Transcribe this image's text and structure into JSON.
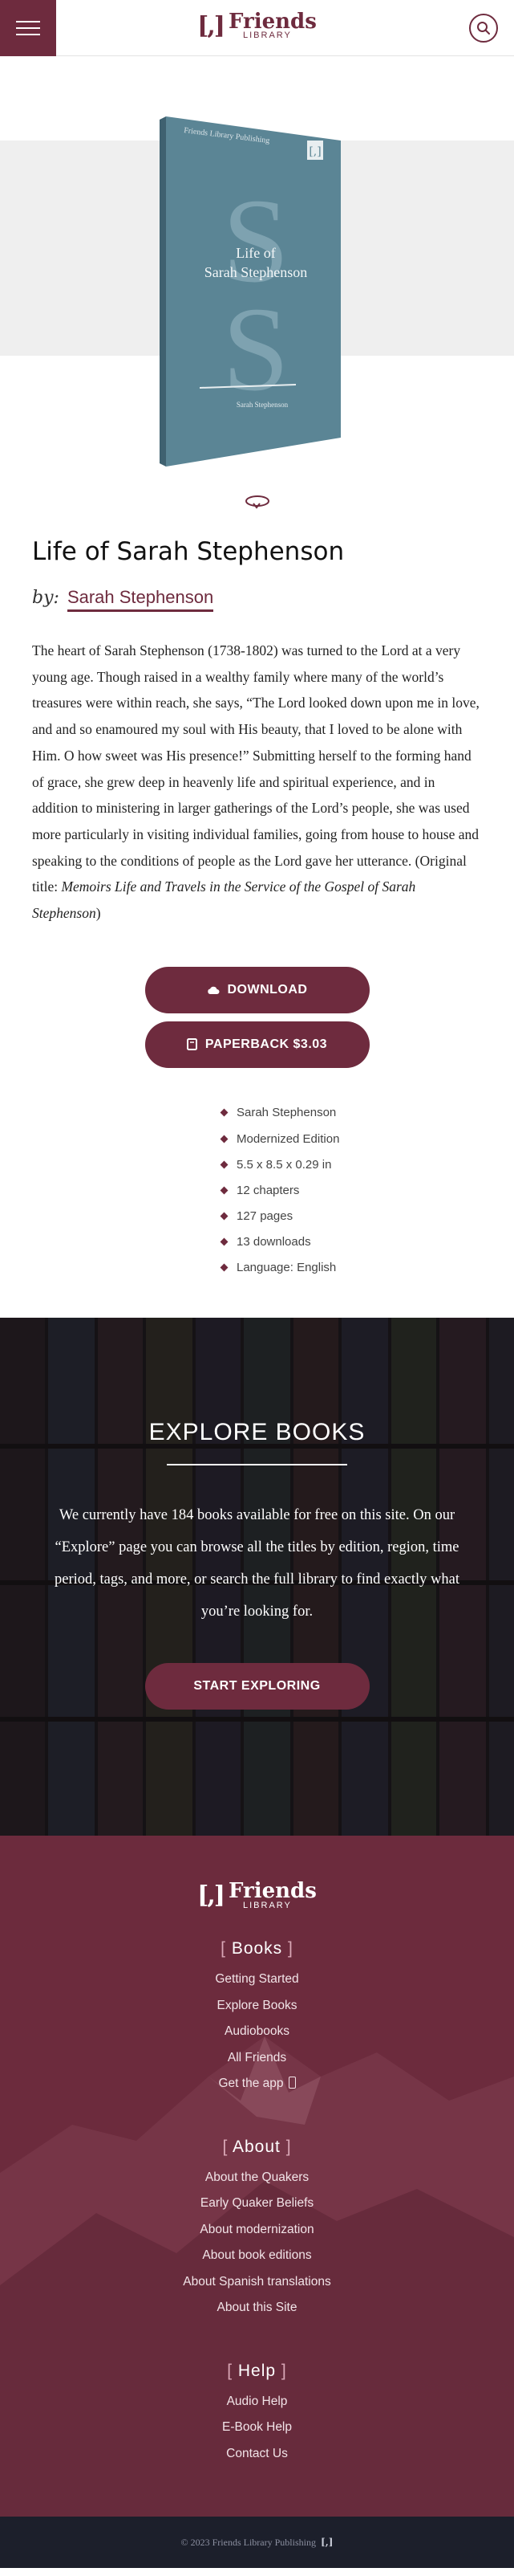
{
  "header": {
    "logo_bracket": "[,]",
    "logo_word": "Friends",
    "logo_sub": "LIBRARY"
  },
  "cover": {
    "publisher": "Friends Library Publishing",
    "monogram": "S",
    "title_line1": "Life of",
    "title_line2": "Sarah Stephenson",
    "author": "Sarah Stephenson",
    "logo_mark": "[,]",
    "color": "#5b8595"
  },
  "book": {
    "title": "Life of Sarah Stephenson",
    "by_label": "by:",
    "author": "Sarah Stephenson",
    "description": "The heart of Sarah Stephenson (1738-1802) was turned to the Lord at a very young age. Though raised in a wealthy family where many of the world’s treasures were within reach, she says, “The Lord looked down upon me in love, and and so enamoured my soul with His beauty, that I loved to be alone with Him. O how sweet was His presence!” Submitting herself to the forming hand of grace, she grew deep in heavenly life and spiritual experience, and in addition to ministering in larger gatherings of the Lord’s people, she was used more particularly in visiting individual families, going from house to house and speaking to the conditions of people as the Lord gave her utterance. (Original title: ",
    "original_title": "Memoirs Life and Travels in the Service of the Gospel of Sarah Stephenson",
    "closing": ")"
  },
  "actions": {
    "download": "DOWNLOAD",
    "paperback": "PAPERBACK $3.03"
  },
  "meta": [
    "Sarah Stephenson",
    "Modernized Edition",
    "5.5 x 8.5 x 0.29 in",
    "12 chapters",
    "127 pages",
    "13 downloads",
    "Language: English"
  ],
  "explore": {
    "heading": "EXPLORE BOOKS",
    "body": "We currently have 184 books available for free on this site. On our “Explore” page you can browse all the titles by edition, region, time period, tags, and more, or search the full library to find exactly what you’re looking for.",
    "button": "START EXPLORING"
  },
  "footer": {
    "logo_bracket": "[,]",
    "logo_word": "Friends",
    "logo_sub": "LIBRARY",
    "books_heading": "Books",
    "books": [
      "Getting Started",
      "Explore Books",
      "Audiobooks",
      "All Friends",
      "Get the app"
    ],
    "about_heading": "About",
    "about": [
      "About the Quakers",
      "Early Quaker Beliefs",
      "About modernization",
      "About book editions",
      "About Spanish translations",
      "About this Site"
    ],
    "help_heading": "Help",
    "help": [
      "Audio Help",
      "E-Book Help",
      "Contact Us"
    ],
    "copyright": "© 2023 Friends Library Publishing",
    "copyright_mark": "[,]"
  },
  "colors": {
    "brand": "#6e2b3e",
    "footer_bg": "#6c2b3d",
    "bottom_bar": "#1c1f2b"
  },
  "icons": [
    "menu-icon",
    "search-icon",
    "rotate-icon",
    "cloud-icon",
    "book-icon",
    "phone-icon"
  ]
}
